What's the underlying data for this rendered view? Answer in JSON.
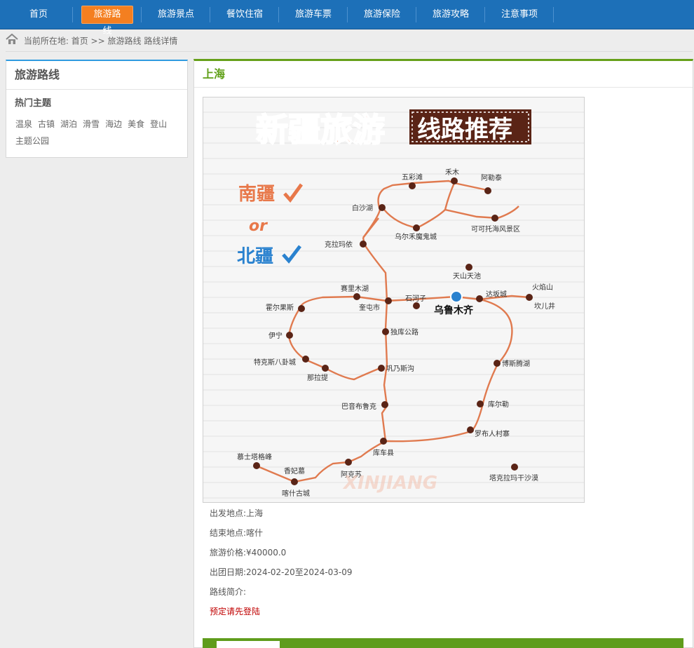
{
  "nav": {
    "items": [
      {
        "label": "首页"
      },
      {
        "label": "旅游路线"
      },
      {
        "label": "旅游景点"
      },
      {
        "label": "餐饮住宿"
      },
      {
        "label": "旅游车票"
      },
      {
        "label": "旅游保险"
      },
      {
        "label": "旅游攻略"
      },
      {
        "label": "注意事项"
      }
    ],
    "active_index": 1,
    "bg_color": "#1d70b8",
    "active_color": "#f47f20"
  },
  "breadcrumb": {
    "prefix": "当前所在地:",
    "home": "首页",
    "sep": ">>",
    "section": "旅游路线",
    "current": "路线详情",
    "icon": "home-icon"
  },
  "sidebar": {
    "title": "旅游路线",
    "subtitle": "热门主题",
    "tags": [
      "温泉",
      "古镇",
      "湖泊",
      "滑雪",
      "海边",
      "美食",
      "登山",
      "主题公园"
    ]
  },
  "main": {
    "title": "上海",
    "accent": "#66a019"
  },
  "poster": {
    "title_left": "新疆旅游",
    "title_right": "线路推荐",
    "south": "南疆",
    "or": "or",
    "north": "北疆",
    "watermark": "XINJIANG",
    "center_city": "乌鲁木齐",
    "places": [
      "五彩滩",
      "禾木",
      "阿勒泰",
      "白沙湖",
      "可可托海风景区",
      "乌尔禾魔鬼城",
      "克拉玛依",
      "天山天池",
      "赛里木湖",
      "石河子",
      "达坂城",
      "火焰山",
      "坎儿井",
      "霍尔果斯",
      "奎屯市",
      "伊宁",
      "独库公路",
      "特克斯八卦城",
      "博斯腾湖",
      "那拉提",
      "巩乃斯沟",
      "巴音布鲁克",
      "库尔勒",
      "罗布人村寨",
      "库车县",
      "慕士塔格峰",
      "香妃墓",
      "阿克苏",
      "塔克拉玛干沙漠",
      "喀什古城"
    ]
  },
  "details": {
    "depart_label": "出发地点:",
    "depart": "上海",
    "end_label": "结束地点:",
    "end": "喀什",
    "price_label": "旅游价格:",
    "price": "¥40000.0",
    "date_label": "出团日期:",
    "date": "2024-02-20至2024-03-09",
    "intro_label": "路线简介:",
    "book_link": "预定请先登陆"
  }
}
